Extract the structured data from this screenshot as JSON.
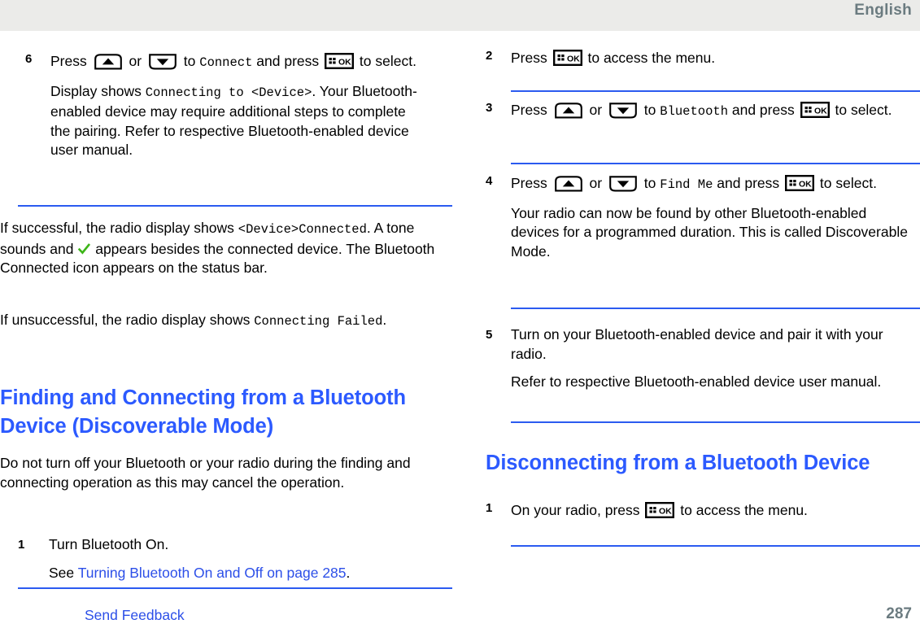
{
  "header": {
    "language": "English"
  },
  "footer": {
    "send_feedback": "Send Feedback",
    "page_number": "287"
  },
  "icons": {
    "up_arrow": "up-arrow-button-icon",
    "down_arrow": "down-arrow-button-icon",
    "menu_ok": "menu-ok-button-icon",
    "check": "green-check-icon"
  },
  "left_column": {
    "step6": {
      "number": "6",
      "line1_a": "Press",
      "line1_b": "or",
      "line1_c": "to",
      "line1_mono": "Connect",
      "line1_d": "and press",
      "line1_e": "to select.",
      "extra_a": "Display shows",
      "extra_mono": "Connecting to <Device>",
      "extra_b": ". Your Bluetooth-enabled device may require additional steps to complete the pairing. Refer to respective Bluetooth-enabled device user manual."
    },
    "result_success": {
      "a": "If successful, the radio display shows ",
      "mono": "<Device>Connected",
      "b": ". A tone sounds and ",
      "c": " appears besides the connected device. The Bluetooth Connected icon appears on the status bar."
    },
    "result_fail": {
      "a": "If unsuccessful, the radio display shows ",
      "mono": "Connecting Failed",
      "b": "."
    },
    "section_title": "Finding and Connecting from a Bluetooth Device (Discoverable Mode)",
    "section_intro": "Do not turn off your Bluetooth or your radio during the finding and connecting operation as this may cancel the operation.",
    "step1": {
      "number": "1",
      "body": "Turn Bluetooth On.",
      "see_prefix": "See ",
      "see_link": "Turning Bluetooth On and Off on page 285",
      "see_suffix": "."
    }
  },
  "right_column": {
    "step2": {
      "number": "2",
      "a": "Press",
      "b": "to access the menu."
    },
    "step3": {
      "number": "3",
      "a": "Press",
      "b": "or",
      "c": "to",
      "mono": "Bluetooth",
      "d": "and press",
      "e": "to select."
    },
    "step4": {
      "number": "4",
      "a": "Press",
      "b": "or",
      "c": "to",
      "mono": "Find Me",
      "d": "and press",
      "e": "to select.",
      "extra": "Your radio can now be found by other Bluetooth-enabled devices for a programmed duration. This is called Discoverable Mode."
    },
    "step5": {
      "number": "5",
      "body": "Turn on your Bluetooth-enabled device and pair it with your radio.",
      "extra": "Refer to respective Bluetooth-enabled device user manual."
    },
    "section_title": "Disconnecting from a Bluetooth Device",
    "step1": {
      "number": "1",
      "a": "On your radio, press",
      "b": "to access the menu."
    }
  },
  "colors": {
    "heading_blue": "#2c5aff",
    "link_blue": "#2c4fe8",
    "rule_blue": "#2b5bf0",
    "header_gray": "#6b7b80",
    "header_band": "#ebebe9",
    "check_green": "#3cb518"
  }
}
